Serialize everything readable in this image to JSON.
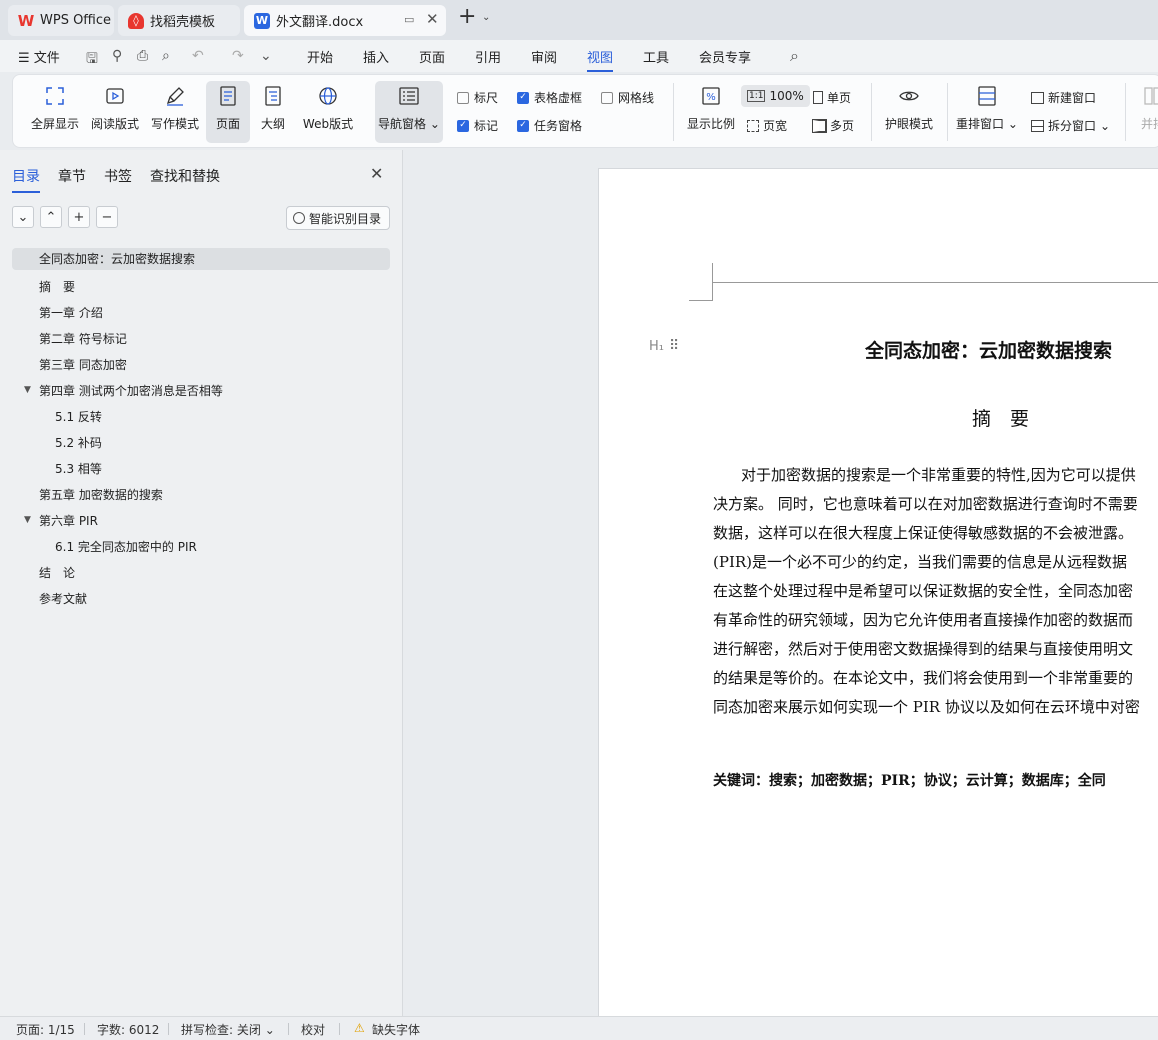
{
  "tabs": [
    {
      "label": "WPS Office",
      "icon": "wps-logo-icon"
    },
    {
      "label": "找稻壳模板",
      "icon": "docer-logo-icon"
    },
    {
      "label": "外文翻译.docx",
      "icon": "word-doc-icon"
    }
  ],
  "menu": {
    "file": "文件",
    "items": [
      "开始",
      "插入",
      "页面",
      "引用",
      "审阅",
      "视图",
      "工具",
      "会员专享"
    ],
    "selected": "视图"
  },
  "ribbon": {
    "buttons": {
      "fullscreen": "全屏显示",
      "read_mode": "阅读版式",
      "write_mode": "写作模式",
      "page": "页面",
      "outline": "大纲",
      "web": "Web版式",
      "nav_pane": "导航窗格",
      "zoom": "显示比例",
      "eye_care": "护眼模式",
      "rearrange": "重排窗口",
      "split": "拆分窗口",
      "new_window": "新建窗口",
      "side_by_side": "并排"
    },
    "checkboxes": {
      "ruler": {
        "label": "标尺",
        "checked": false
      },
      "table_gridlines": {
        "label": "表格虚框",
        "checked": true
      },
      "grid": {
        "label": "网格线",
        "checked": false
      },
      "marks": {
        "label": "标记",
        "checked": true
      },
      "task_pane": {
        "label": "任务窗格",
        "checked": true
      }
    },
    "zoom_100": "100%",
    "single_page": "单页",
    "page_width": "页宽",
    "multi_page": "多页"
  },
  "nav_panel": {
    "tabs": [
      "目录",
      "章节",
      "书签",
      "查找和替换"
    ],
    "selected_tab": "目录",
    "smart_toc": "智能识别目录",
    "toc": [
      {
        "label": "全同态加密：云加密数据搜索",
        "level": 1,
        "selected": true
      },
      {
        "label": "摘　要",
        "level": 1
      },
      {
        "label": "第一章 介绍",
        "level": 1
      },
      {
        "label": "第二章 符号标记",
        "level": 1
      },
      {
        "label": "第三章 同态加密",
        "level": 1
      },
      {
        "label": "第四章 测试两个加密消息是否相等",
        "level": 1,
        "expanded": true
      },
      {
        "label": "5.1 反转",
        "level": 2
      },
      {
        "label": "5.2 补码",
        "level": 2
      },
      {
        "label": "5.3 相等",
        "level": 2
      },
      {
        "label": "第五章 加密数据的搜索",
        "level": 1
      },
      {
        "label": "第六章 PIR",
        "level": 1,
        "expanded": true
      },
      {
        "label": "6.1 完全同态加密中的 PIR",
        "level": 2
      },
      {
        "label": "结　论",
        "level": 1
      },
      {
        "label": "参考文献",
        "level": 1
      }
    ]
  },
  "document": {
    "title": "全同态加密：云加密数据搜索",
    "abstract_heading": "摘　要",
    "paragraph_lines": [
      "对于加密数据的搜索是一个非常重要的特性,因为它可以提供",
      "决方案。 同时，它也意味着可以在对加密数据进行查询时不需要",
      "数据，这样可以在很大程度上保证使得敏感数据的不会被泄露。",
      "(PIR)是一个必不可少的约定，当我们需要的信息是从远程数据",
      "在这整个处理过程中是希望可以保证数据的安全性，全同态加密",
      "有革命性的研究领域，因为它允许使用者直接操作加密的数据而",
      "进行解密，然后对于使用密文数据操得到的结果与直接使用明文",
      "的结果是等价的。在本论文中，我们将会使用到一个非常重要的",
      "同态加密来展示如何实现一个 PIR 协议以及如何在云环境中对密"
    ],
    "keywords": "关键词：搜索；加密数据；PIR；协议；云计算；数据库；全同"
  },
  "status": {
    "page": "页面: 1/15",
    "words": "字数: 6012",
    "spell": "拼写检查: 关闭",
    "proof": "校对",
    "missing_font": "缺失字体"
  },
  "colors": {
    "accent": "#2b5fd9",
    "wps_red": "#e8362f",
    "word_blue": "#2b67e0"
  }
}
